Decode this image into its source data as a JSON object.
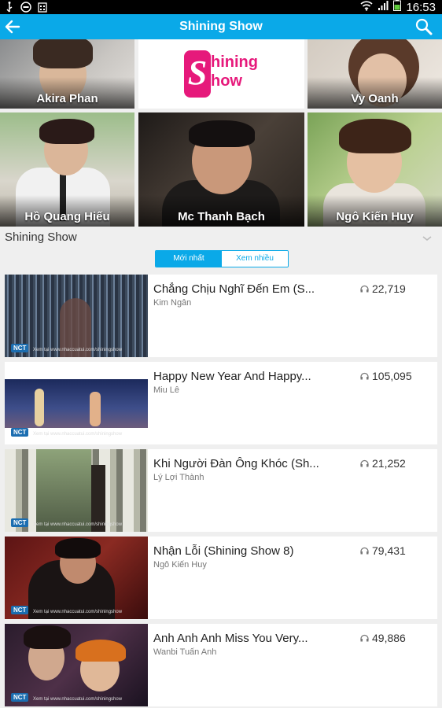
{
  "status_bar": {
    "time": "16:53"
  },
  "app_bar": {
    "title": "Shining Show"
  },
  "artists": [
    {
      "name": "Akira Phan"
    },
    {
      "name": "Shining Show"
    },
    {
      "name": "Vy Oanh"
    },
    {
      "name": "Hồ Quang Hiếu"
    },
    {
      "name": "Mc Thanh Bạch"
    },
    {
      "name": "Ngô Kiến Huy"
    }
  ],
  "logo": {
    "line1": "hining",
    "line2": "how",
    "letter": "S"
  },
  "section": {
    "title": "Shining Show"
  },
  "tabs": {
    "newest": "Mới nhất",
    "most_viewed": "Xem nhiều"
  },
  "videos": [
    {
      "title": "Chẳng Chịu Nghĩ Đến Em (S...",
      "artist": "Kim Ngân",
      "listens": "22,719"
    },
    {
      "title": "Happy New Year And Happy...",
      "artist": "Miu Lê",
      "listens": "105,095"
    },
    {
      "title": "Khi Người Đàn Ông Khóc (Sh...",
      "artist": "Lý Lợi Thành",
      "listens": "21,252"
    },
    {
      "title": "Nhận Lỗi (Shining Show 8)",
      "artist": "Ngô Kiến Huy",
      "listens": "79,431"
    },
    {
      "title": "Anh Anh Anh Miss You Very...",
      "artist": "Wanbi Tuấn Anh",
      "listens": "49,886"
    }
  ],
  "thumb_badge": {
    "label": "NCT",
    "watermark": "Xem tại www.nhaccuatui.com/shiningshow"
  },
  "colors": {
    "accent": "#0aa9e8",
    "logo_pink": "#e6197b"
  }
}
